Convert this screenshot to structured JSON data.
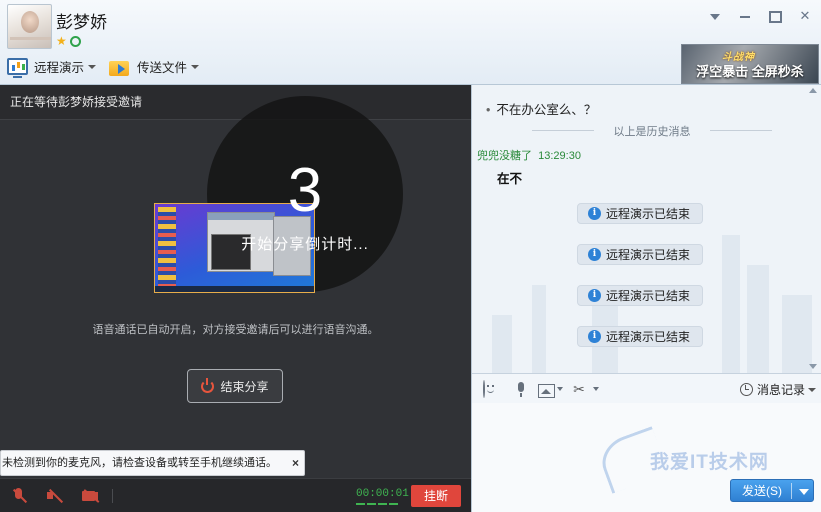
{
  "contact": {
    "name": "彭梦娇"
  },
  "toolbar": {
    "remote_demo": "远程演示",
    "send_file": "传送文件"
  },
  "ad": {
    "logo": "斗战神",
    "slogan": "浮空暴击 全屏秒杀"
  },
  "share": {
    "header": "正在等待彭梦娇接受邀请",
    "countdown": "3",
    "countdown_text": "开始分享倒计时...",
    "voice_note": "语音通话已自动开启，对方接受邀请后可以进行语音沟通。",
    "end_share": "结束分享",
    "mic_warning": "未检测到你的麦克风，请检查设备或转至手机继续通话。",
    "mic_warning_close": "×",
    "timer": "00:00:01",
    "hangup": "挂断"
  },
  "chat": {
    "history_message": "不在办公室么、？",
    "history_separator": "以上是历史消息",
    "sender": "兜兜没糖了",
    "time": "13:29:30",
    "message": "在不",
    "system_messages": [
      "远程演示已结束",
      "远程演示已结束",
      "远程演示已结束",
      "远程演示已结束"
    ],
    "history_button": "消息记录",
    "send_button": "发送(S)",
    "watermark": "我爱IT技术网"
  },
  "colors": {
    "accent": "#2f80d2",
    "hangup": "#e0463c",
    "timer": "#3fb451"
  }
}
